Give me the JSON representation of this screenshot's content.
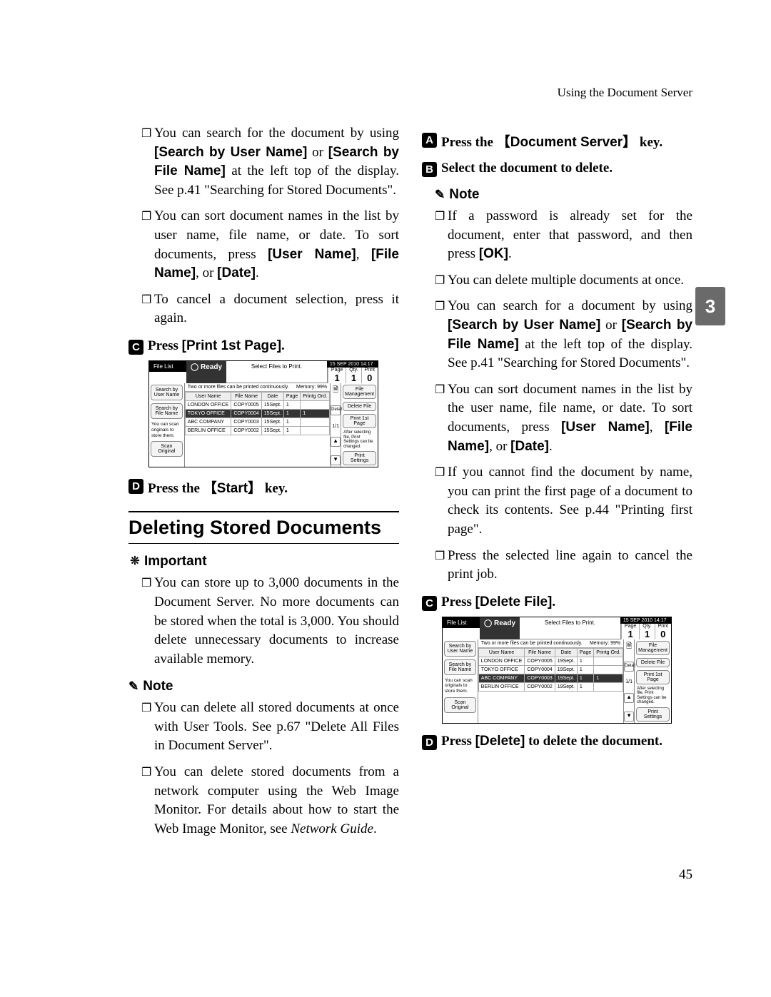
{
  "header": "Using the Document Server",
  "page_number": "45",
  "side_tab": "3",
  "left": {
    "bullets_top": [
      {
        "pre": "You can search for the document by using ",
        "b1": "[Search by User Name]",
        "mid": " or ",
        "b2": "[Search by File Name]",
        "post": " at the left top of the display. See p.41 \"Searching for Stored Documents\"."
      },
      {
        "pre": "You can sort document names in the list by user name, file name, or date. To sort documents, press ",
        "b1": "[User Name]",
        "mid": ", ",
        "b2": "[File Name]",
        "post2": ", or ",
        "b3": "[Date]",
        "post": "."
      },
      {
        "plain": "To cancel a document selection, press it again."
      }
    ],
    "stepC": {
      "num": "C",
      "pre": "Press ",
      "b": "[Print 1st Page]",
      "post": "."
    },
    "stepD": {
      "num": "D",
      "pre": "Press the ",
      "key": "Start",
      "post": " key."
    },
    "section": "Deleting Stored Documents",
    "important_label": "Important",
    "important_bullet": "You can store up to 3,000 documents in the Document Server. No more documents can be stored when the total is 3,000. You should delete unnecessary documents to increase available memory.",
    "note_label": "Note",
    "note_bullets": [
      "You can delete all stored documents at once with User Tools. See p.67 \"Delete All Files in Document Server\".",
      {
        "pre": "You can delete stored documents from a network computer using the Web Image Monitor. For details about how to start the Web Image Monitor, see ",
        "em": "Network Guide",
        "post": "."
      }
    ]
  },
  "right": {
    "stepA": {
      "num": "A",
      "pre": "Press the ",
      "key": "Document Server",
      "post": " key."
    },
    "stepB": {
      "num": "B",
      "text": "Select the document to delete."
    },
    "note_label": "Note",
    "bullets": [
      {
        "pre": "If a password is already set for the document, enter that password, and then press ",
        "b": "[OK]",
        "post": "."
      },
      {
        "plain": "You can delete multiple documents at once."
      },
      {
        "pre": "You can search for a document by using ",
        "b1": "[Search by User Name]",
        "mid": " or ",
        "b2": "[Search by File Name]",
        "post": " at the left top of the display. See p.41 \"Searching for Stored Documents\"."
      },
      {
        "pre": "You can sort document names in the list by the user name, file name, or date. To sort documents, press ",
        "b1": "[User Name]",
        "mid": ", ",
        "b2": "[File Name]",
        "post2": ", or ",
        "b3": "[Date]",
        "post": "."
      },
      {
        "plain": "If you cannot find the document by name, you can print the first page of a document to check its contents. See p.44 \"Printing first page\"."
      },
      {
        "plain": "Press the selected line again to cancel the print job."
      }
    ],
    "stepC": {
      "num": "C",
      "pre": "Press ",
      "b": "[Delete File]",
      "post": "."
    },
    "stepD": {
      "num": "D",
      "pre": "Press ",
      "b": "[Delete]",
      "post": " to delete the document."
    }
  },
  "screenshot1": {
    "tab": "File List",
    "ready": "Ready",
    "title": "Select Files to Print.",
    "date": "15 SEP 2010 14:17",
    "counters": [
      {
        "label": "Page",
        "val": "1"
      },
      {
        "label": "Qty.",
        "val": "1"
      },
      {
        "label": "Print",
        "val": "0"
      }
    ],
    "left_btns": [
      "Search by User Name",
      "Search by File Name"
    ],
    "left_hint": "You can scan originals to store them.",
    "left_btn_bottom": "Scan Original",
    "msg": "Two or more files can be printed continuously.",
    "mem": "Memory:  99%",
    "cols": [
      "User Name",
      "File Name",
      "Date",
      "Page",
      "Printg Ord."
    ],
    "rows": [
      {
        "u": "LONDON OFFICE",
        "f": "COPY0005",
        "d": "15Sept.",
        "p": "1",
        "o": ""
      },
      {
        "u": "TOKYO OFFICE",
        "f": "COPY0004",
        "d": "15Sept.",
        "p": "1",
        "o": "1",
        "sel": true
      },
      {
        "u": "ABC COMPANY",
        "f": "COPY0003",
        "d": "15Sept.",
        "p": "1",
        "o": ""
      },
      {
        "u": "BERLIN OFFICE",
        "f": "COPY0002",
        "d": "15Sept.",
        "p": "1",
        "o": ""
      }
    ],
    "scroll_ind": "1/1",
    "right_btns_top": [
      "File Management",
      "Delete File",
      "Print 1st Page"
    ],
    "right_note": "After selecting file, Print Settings can be changed.",
    "right_btn_bottom": "Print Settings",
    "detail": "Detail"
  },
  "screenshot2": {
    "tab": "File List",
    "ready": "Ready",
    "title": "Select Files to Print.",
    "date": "15 SEP 2010 14:17",
    "counters": [
      {
        "label": "Page",
        "val": "1"
      },
      {
        "label": "Qty.",
        "val": "1"
      },
      {
        "label": "Print",
        "val": "0"
      }
    ],
    "left_btns": [
      "Search by User Name",
      "Search by File Name"
    ],
    "left_hint": "You can scan originals to store them.",
    "left_btn_bottom": "Scan Original",
    "msg": "Two or more files can be printed continuously.",
    "mem": "Memory:  99%",
    "cols": [
      "User Name",
      "File Name",
      "Date",
      "Page",
      "Printg Ord."
    ],
    "rows": [
      {
        "u": "LONDON OFFICE",
        "f": "COPY0005",
        "d": "19Sept.",
        "p": "1",
        "o": ""
      },
      {
        "u": "TOKYO OFFICE",
        "f": "COPY0004",
        "d": "19Sept.",
        "p": "1",
        "o": ""
      },
      {
        "u": "ABC COMPANY",
        "f": "COPY0003",
        "d": "19Sept.",
        "p": "1",
        "o": "1",
        "sel": true
      },
      {
        "u": "BERLIN OFFICE",
        "f": "COPY0002",
        "d": "19Sept.",
        "p": "1",
        "o": ""
      }
    ],
    "scroll_ind": "1/1",
    "right_btns_top": [
      "File Management",
      "Delete File",
      "Print 1st Page"
    ],
    "right_note": "After selecting file, Print Settings can be changed.",
    "right_btn_bottom": "Print Settings",
    "detail": "Detail"
  }
}
